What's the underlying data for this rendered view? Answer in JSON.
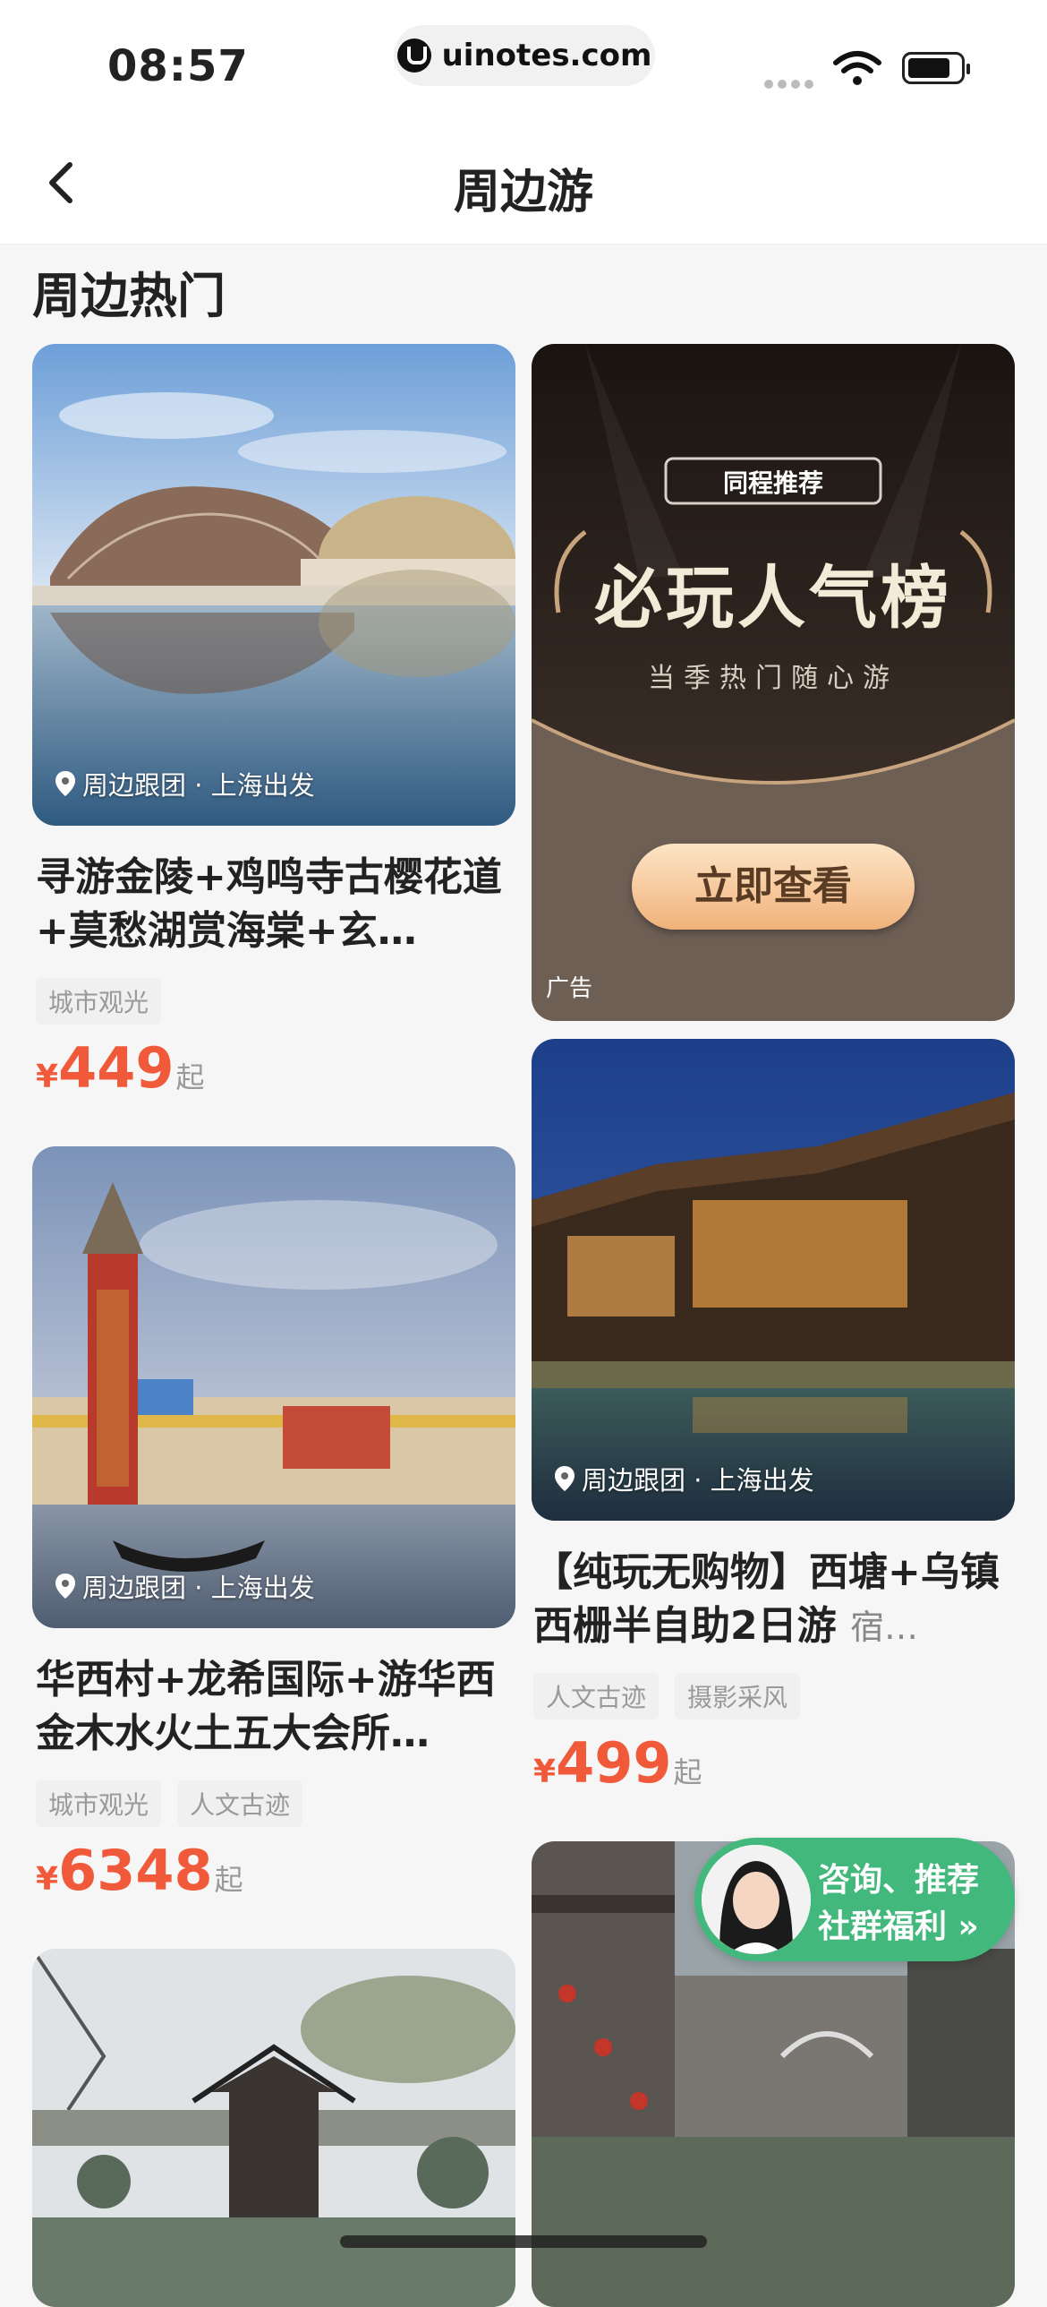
{
  "status_bar": {
    "time": "08:57",
    "url": "uinotes.com"
  },
  "nav": {
    "title": "周边游"
  },
  "section_title": "周边热门",
  "cards": [
    {
      "location": "周边跟团 · 上海出发",
      "title": "寻游金陵+鸡鸣寺古樱花道+莫愁湖赏海棠+玄…",
      "tags": [
        "城市观光"
      ],
      "currency": "¥",
      "price": "449",
      "suffix": "起"
    },
    {
      "location": "周边跟团 · 上海出发",
      "title": "华西村+龙希国际+游华西金木水火土五大会所…",
      "tags": [
        "城市观光",
        "人文古迹"
      ],
      "currency": "¥",
      "price": "6348",
      "suffix": "起"
    },
    {
      "location": "周边跟团 · 上海出发",
      "title": "【纯玩无购物】西塘+乌镇西栅半自助2日游",
      "subtitle": "宿…",
      "tags": [
        "人文古迹",
        "摄影采风"
      ],
      "currency": "¥",
      "price": "499",
      "suffix": "起"
    }
  ],
  "ad": {
    "brand": "同程推荐",
    "headline": "必玩人气榜",
    "tagline": "当季热门随心游",
    "button": "立即查看",
    "label": "广告"
  },
  "consult": {
    "line1": "咨询、推荐",
    "line2": "社群福利 »"
  }
}
